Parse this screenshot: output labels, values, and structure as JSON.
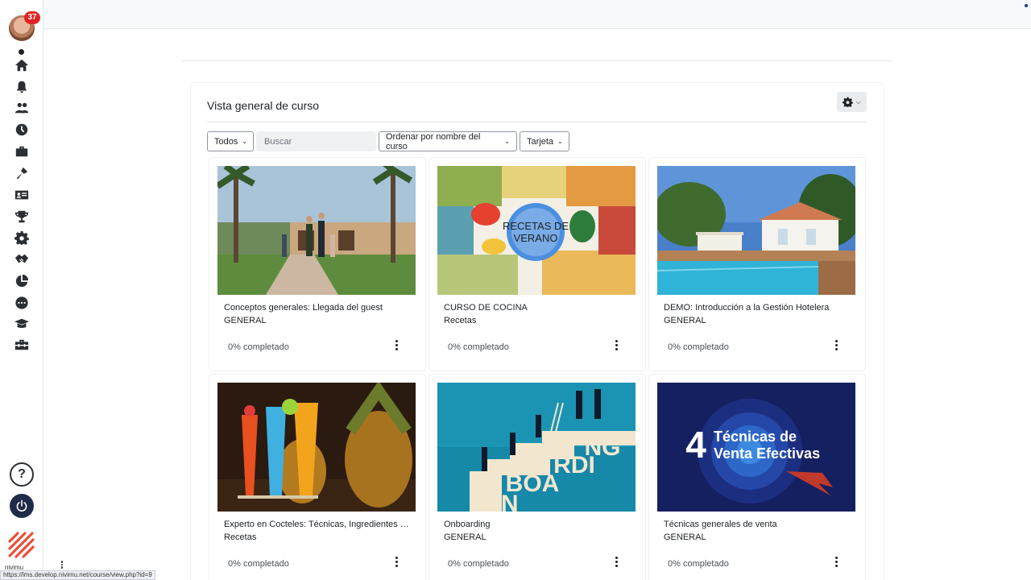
{
  "sidebar": {
    "notification_count": "37",
    "icons": [
      "home-icon",
      "bell-icon",
      "users-icon",
      "clock-icon",
      "briefcase-icon",
      "tools-icon",
      "id-card-icon",
      "trophy-icon",
      "gear-icon",
      "handshake-icon",
      "pie-chart-icon",
      "chat-icon",
      "graduation-cap-icon",
      "toolbox-icon"
    ],
    "help_label": "?",
    "brand": "nivimu"
  },
  "block": {
    "title": "Vista general de curso",
    "filters": {
      "grouping": "Todos",
      "search_placeholder": "Buscar",
      "sort": "Ordenar por nombre del curso",
      "view": "Tarjeta"
    }
  },
  "courses": [
    {
      "name": "Conceptos generales: Llegada del guest",
      "category": "GENERAL",
      "progress": "0% completado"
    },
    {
      "name": "CURSO DE COCINA",
      "category": "Recetas",
      "progress": "0% completado",
      "image_text": "RECETAS DE VERANO"
    },
    {
      "name": "DEMO: Introducción a la Gestión Hotelera",
      "category": "GENERAL",
      "progress": "0% completado"
    },
    {
      "name": "Experto en Cocteles: Técnicas, Ingredientes y ...",
      "category": "Recetas",
      "progress": "0% completado"
    },
    {
      "name": "Onboarding",
      "category": "GENERAL",
      "progress": "0% completado",
      "image_text": [
        "NG",
        "RDI",
        "BOA",
        "ON"
      ]
    },
    {
      "name": "Técnicas generales de venta",
      "category": "GENERAL",
      "progress": "0% completado",
      "image_text": [
        "4",
        "Técnicas de",
        "Venta Efectivas"
      ]
    }
  ],
  "status_bar": {
    "url": "https://lms.develop.nivimu.net/course/view.php?id=9"
  }
}
